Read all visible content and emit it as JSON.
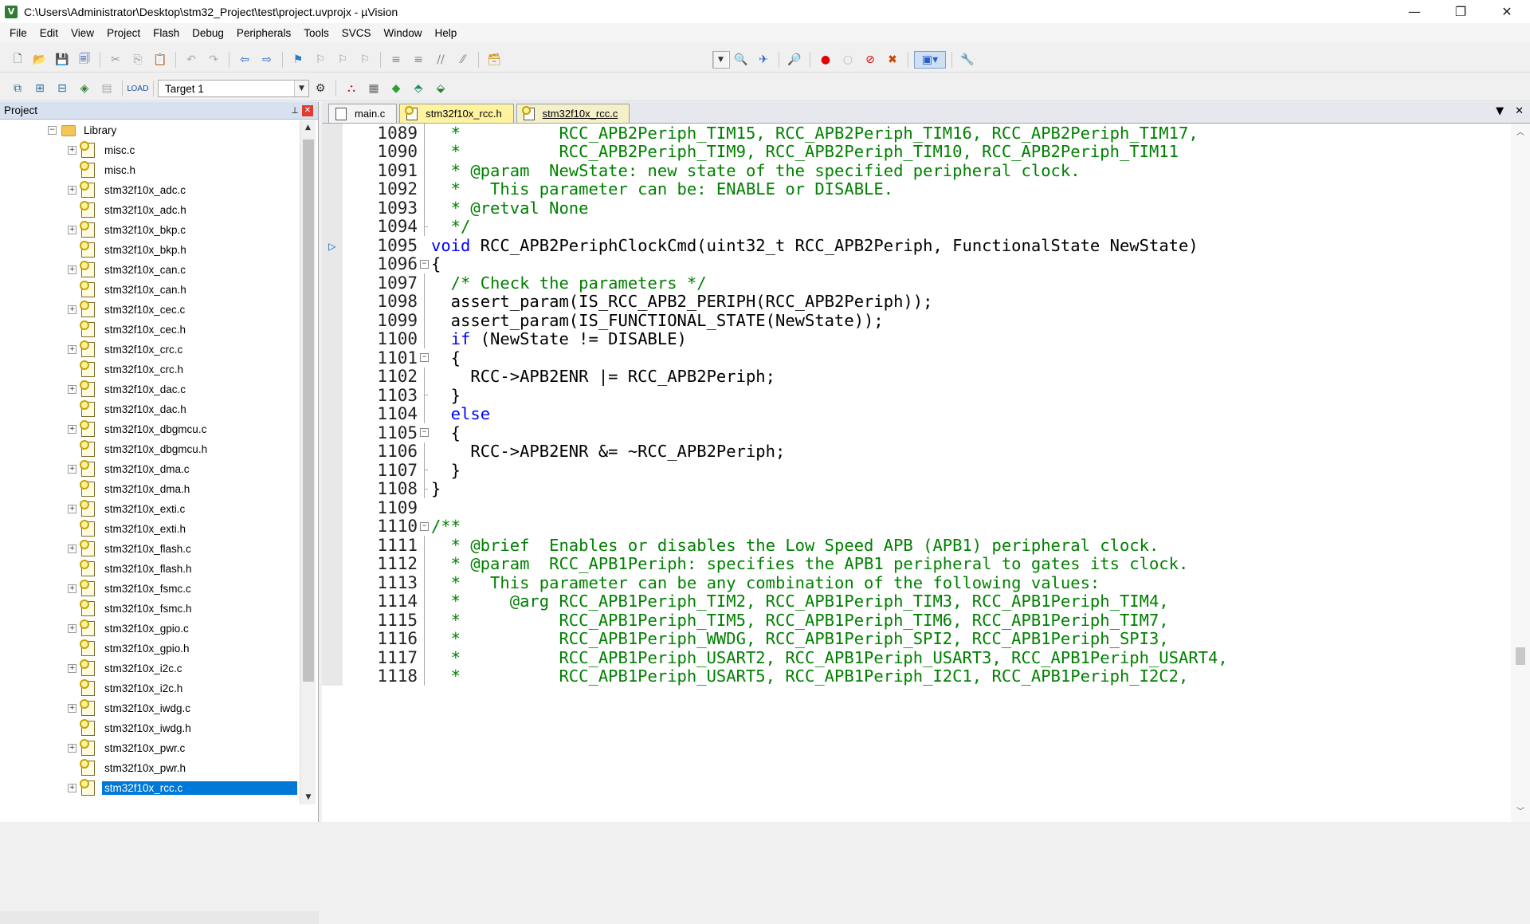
{
  "window": {
    "title": "C:\\Users\\Administrator\\Desktop\\stm32_Project\\test\\project.uvprojx - µVision",
    "minimize": "—",
    "restore": "❐",
    "close": "✕"
  },
  "menu": [
    "File",
    "Edit",
    "View",
    "Project",
    "Flash",
    "Debug",
    "Peripherals",
    "Tools",
    "SVCS",
    "Window",
    "Help"
  ],
  "toolbar2": {
    "target": "Target 1"
  },
  "project_panel": {
    "title": "Project",
    "pin": "⊥",
    "close": "✕",
    "folder": "Library",
    "files": [
      "misc.c",
      "misc.h",
      "stm32f10x_adc.c",
      "stm32f10x_adc.h",
      "stm32f10x_bkp.c",
      "stm32f10x_bkp.h",
      "stm32f10x_can.c",
      "stm32f10x_can.h",
      "stm32f10x_cec.c",
      "stm32f10x_cec.h",
      "stm32f10x_crc.c",
      "stm32f10x_crc.h",
      "stm32f10x_dac.c",
      "stm32f10x_dac.h",
      "stm32f10x_dbgmcu.c",
      "stm32f10x_dbgmcu.h",
      "stm32f10x_dma.c",
      "stm32f10x_dma.h",
      "stm32f10x_exti.c",
      "stm32f10x_exti.h",
      "stm32f10x_flash.c",
      "stm32f10x_flash.h",
      "stm32f10x_fsmc.c",
      "stm32f10x_fsmc.h",
      "stm32f10x_gpio.c",
      "stm32f10x_gpio.h",
      "stm32f10x_i2c.c",
      "stm32f10x_i2c.h",
      "stm32f10x_iwdg.c",
      "stm32f10x_iwdg.h",
      "stm32f10x_pwr.c",
      "stm32f10x_pwr.h",
      "stm32f10x_rcc.c"
    ],
    "selected_file": "stm32f10x_rcc.c"
  },
  "editor": {
    "tabs": [
      {
        "label": "main.c",
        "style": "plain"
      },
      {
        "label": "stm32f10x_rcc.h",
        "style": "yellow"
      },
      {
        "label": "stm32f10x_rcc.c",
        "style": "active"
      }
    ],
    "lines": [
      {
        "n": "1089",
        "t": "  *          RCC_APB2Periph_TIM15, RCC_APB2Periph_TIM16, RCC_APB2Periph_TIM17,",
        "k": "cm"
      },
      {
        "n": "1090",
        "t": "  *          RCC_APB2Periph_TIM9, RCC_APB2Periph_TIM10, RCC_APB2Periph_TIM11",
        "k": "cm"
      },
      {
        "n": "1091",
        "t": "  * @param  NewState: new state of the specified peripheral clock.",
        "k": "cm"
      },
      {
        "n": "1092",
        "t": "  *   This parameter can be: ENABLE or DISABLE.",
        "k": "cm"
      },
      {
        "n": "1093",
        "t": "  * @retval None",
        "k": "cm"
      },
      {
        "n": "1094",
        "t": "  */",
        "k": "cm"
      },
      {
        "n": "1095",
        "t": "void RCC_APB2PeriphClockCmd(uint32_t RCC_APB2Periph, FunctionalState NewState)",
        "k": "fn"
      },
      {
        "n": "1096",
        "t": "{",
        "k": "tx"
      },
      {
        "n": "1097",
        "t": "  /* Check the parameters */",
        "k": "cm"
      },
      {
        "n": "1098",
        "t": "  assert_param(IS_RCC_APB2_PERIPH(RCC_APB2Periph));",
        "k": "tx"
      },
      {
        "n": "1099",
        "t": "  assert_param(IS_FUNCTIONAL_STATE(NewState));",
        "k": "tx"
      },
      {
        "n": "1100",
        "t": "  if (NewState != DISABLE)",
        "k": "if"
      },
      {
        "n": "1101",
        "t": "  {",
        "k": "tx"
      },
      {
        "n": "1102",
        "t": "    RCC->APB2ENR |= RCC_APB2Periph;",
        "k": "tx"
      },
      {
        "n": "1103",
        "t": "  }",
        "k": "tx"
      },
      {
        "n": "1104",
        "t": "  else",
        "k": "kw"
      },
      {
        "n": "1105",
        "t": "  {",
        "k": "tx"
      },
      {
        "n": "1106",
        "t": "    RCC->APB2ENR &= ~RCC_APB2Periph;",
        "k": "tx"
      },
      {
        "n": "1107",
        "t": "  }",
        "k": "tx"
      },
      {
        "n": "1108",
        "t": "}",
        "k": "tx"
      },
      {
        "n": "1109",
        "t": "",
        "k": "tx"
      },
      {
        "n": "1110",
        "t": "/**",
        "k": "cm"
      },
      {
        "n": "1111",
        "t": "  * @brief  Enables or disables the Low Speed APB (APB1) peripheral clock.",
        "k": "cm"
      },
      {
        "n": "1112",
        "t": "  * @param  RCC_APB1Periph: specifies the APB1 peripheral to gates its clock.",
        "k": "cm"
      },
      {
        "n": "1113",
        "t": "  *   This parameter can be any combination of the following values:",
        "k": "cm"
      },
      {
        "n": "1114",
        "t": "  *     @arg RCC_APB1Periph_TIM2, RCC_APB1Periph_TIM3, RCC_APB1Periph_TIM4,",
        "k": "cm"
      },
      {
        "n": "1115",
        "t": "  *          RCC_APB1Periph_TIM5, RCC_APB1Periph_TIM6, RCC_APB1Periph_TIM7,",
        "k": "cm"
      },
      {
        "n": "1116",
        "t": "  *          RCC_APB1Periph_WWDG, RCC_APB1Periph_SPI2, RCC_APB1Periph_SPI3,",
        "k": "cm"
      },
      {
        "n": "1117",
        "t": "  *          RCC_APB1Periph_USART2, RCC_APB1Periph_USART3, RCC_APB1Periph_USART4,",
        "k": "cm"
      },
      {
        "n": "1118",
        "t": "  *          RCC_APB1Periph_USART5, RCC_APB1Periph_I2C1, RCC_APB1Periph_I2C2,",
        "k": "cm"
      }
    ]
  },
  "colors": {
    "comment": "#008000",
    "keyword": "#0000ff",
    "selection": "#0078d7"
  }
}
